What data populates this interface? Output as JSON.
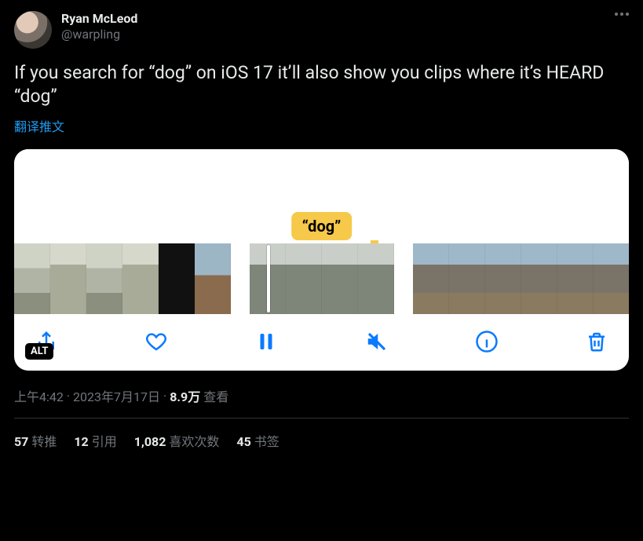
{
  "header": {
    "displayName": "Ryan McLeod",
    "handle": "@warpling"
  },
  "tweet": {
    "text": "If you search for “dog” on iOS 17 it’ll also show you clips where it’s HEARD “dog”",
    "translate": "翻译推文"
  },
  "media": {
    "bubble": "“dog”",
    "altBadge": "ALT"
  },
  "meta": {
    "time": "上午4:42",
    "dot1": " · ",
    "date": "2023年7月17日",
    "dot2": " · ",
    "viewsNum": "8.9万",
    "viewsLabel": " 查看"
  },
  "stats": {
    "retweetsCount": "57",
    "retweetsLabel": "转推",
    "quotesCount": "12",
    "quotesLabel": "引用",
    "likesCount": "1,082",
    "likesLabel": "喜欢次数",
    "bookmarksCount": "45",
    "bookmarksLabel": "书签"
  }
}
